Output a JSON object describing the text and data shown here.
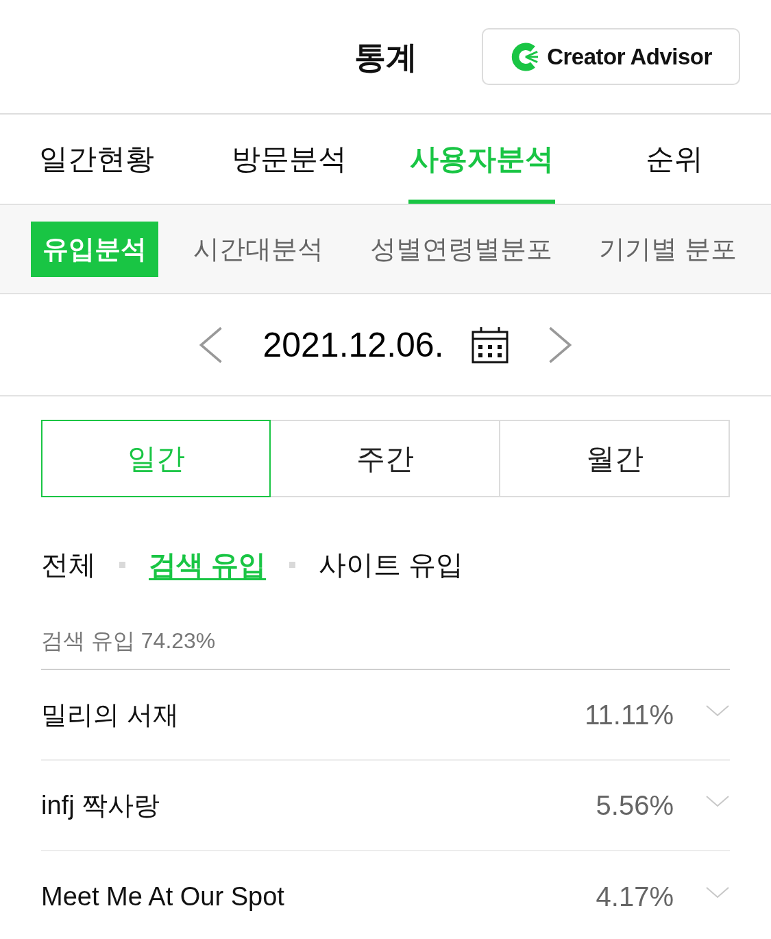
{
  "header": {
    "title": "통계",
    "brand_button": {
      "label": "Creator Advisor"
    }
  },
  "tabs": [
    {
      "label": "일간현황",
      "selected": false
    },
    {
      "label": "방문분석",
      "selected": false
    },
    {
      "label": "사용자분석",
      "selected": true
    },
    {
      "label": "순위",
      "selected": false
    }
  ],
  "sub_tabs": [
    {
      "label": "유입분석",
      "selected": true
    },
    {
      "label": "시간대분석",
      "selected": false
    },
    {
      "label": "성별연령별분포",
      "selected": false
    },
    {
      "label": "기기별 분포",
      "selected": false
    }
  ],
  "date_nav": {
    "date": "2021.12.06."
  },
  "period_tabs": [
    {
      "label": "일간",
      "selected": true
    },
    {
      "label": "주간",
      "selected": false
    },
    {
      "label": "월간",
      "selected": false
    }
  ],
  "source_filters": [
    {
      "label": "전체",
      "selected": false
    },
    {
      "label": "검색 유입",
      "selected": true
    },
    {
      "label": "사이트 유입",
      "selected": false
    }
  ],
  "summary": "검색 유입 74.23%",
  "rows": [
    {
      "name": "밀리의 서재",
      "share": "11.11%",
      "expanded": false
    },
    {
      "name": "infj 짝사랑",
      "share": "5.56%",
      "expanded": false
    },
    {
      "name": "Meet Me At Our Spot",
      "share": "4.17%",
      "expanded": false
    }
  ]
}
